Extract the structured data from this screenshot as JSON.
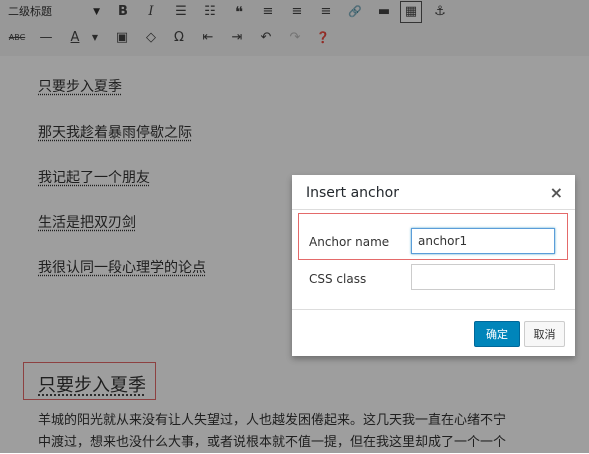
{
  "toolbar": {
    "format_select": "二级标题",
    "row1_icons": [
      "bold-icon",
      "italic-icon",
      "bullet-list-icon",
      "numbered-list-icon",
      "blockquote-icon",
      "align-left-icon",
      "align-center-icon",
      "align-right-icon",
      "link-icon",
      "read-more-icon",
      "toolbar-toggle-icon",
      "anchor-icon"
    ],
    "row2_icons": [
      "strikethrough-icon",
      "horizontal-line-icon",
      "text-color-icon",
      "paste-text-icon",
      "clear-formatting-icon",
      "special-character-icon",
      "outdent-icon",
      "indent-icon",
      "undo-icon",
      "redo-icon",
      "help-icon"
    ],
    "glyphs": {
      "bold": "B",
      "italic": "I",
      "bullets": "☰",
      "numbers": "☷",
      "quote": "❝",
      "align_left": "≡",
      "align_center": "≡",
      "align_right": "≡",
      "link": "🔗",
      "read_more": "▬",
      "kitchen_sink": "▦",
      "anchor": "⚓",
      "strike": "ABC",
      "hr": "—",
      "text_color": "A",
      "paste": "▣",
      "clear": "◇",
      "omega": "Ω",
      "outdent": "⇤",
      "indent": "⇥",
      "undo": "↶",
      "redo": "↷",
      "help": "❓"
    }
  },
  "editor": {
    "paragraphs": [
      "只要步入夏季",
      "那天我趁着暴雨停歇之际",
      "我记起了一个朋友",
      "生活是把双刃剑",
      "我很认同一段心理学的论点"
    ],
    "heading": "只要步入夏季",
    "body_line1": "羊城的阳光就从来没有让人失望过，人也越发困倦起来。这几天我一直在心绪不宁",
    "body_line2": "中渡过，想来也没什么大事，或者说根本就不值一提，但在我这里却成了一个一个"
  },
  "dialog": {
    "title": "Insert anchor",
    "close": "×",
    "anchor_label": "Anchor name",
    "anchor_value": "anchor1",
    "css_label": "CSS class",
    "css_value": "",
    "ok": "确定",
    "cancel": "取消"
  },
  "colors": {
    "primary": "#0085ba",
    "highlight_border": "#e46a6a"
  }
}
